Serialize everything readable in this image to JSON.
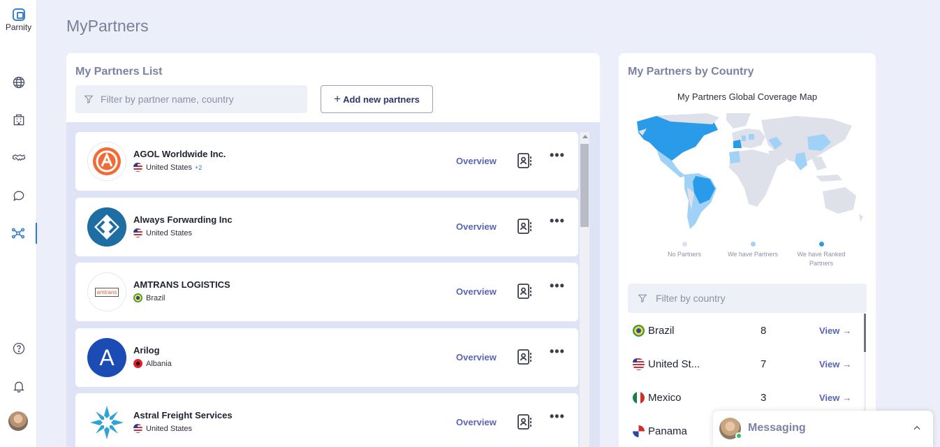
{
  "app": {
    "logo_text": "Parnity",
    "page_title": "MyPartners"
  },
  "sidebar": {
    "items": [
      {
        "name": "globe-icon"
      },
      {
        "name": "building-icon"
      },
      {
        "name": "handshake-icon"
      },
      {
        "name": "chat-icon"
      },
      {
        "name": "network-icon",
        "active": true
      },
      {
        "name": "help-icon"
      },
      {
        "name": "bell-icon"
      }
    ]
  },
  "partners_list": {
    "title": "My Partners List",
    "filter_placeholder": "Filter by partner name, country",
    "add_button_label": "Add new partners",
    "overview_label": "Overview",
    "partners": [
      {
        "name": "AGOL Worldwide Inc.",
        "country": "United States",
        "extra": "+2",
        "flag": "us"
      },
      {
        "name": "Always Forwarding Inc",
        "country": "United States",
        "extra": "",
        "flag": "us"
      },
      {
        "name": "AMTRANS LOGISTICS",
        "country": "Brazil",
        "extra": "",
        "flag": "br",
        "logo_text": "amtrans"
      },
      {
        "name": "Arilog",
        "country": "Albania",
        "extra": "",
        "flag": "al",
        "logo_text": "A"
      },
      {
        "name": "Astral Freight Services",
        "country": "United States",
        "extra": "",
        "flag": "us"
      }
    ]
  },
  "by_country": {
    "title": "My Partners by Country",
    "map_title": "My Partners Global Coverage Map",
    "legend": [
      {
        "label": "No Partners",
        "color": "#dfe1ea"
      },
      {
        "label": "We have Partners",
        "color": "#9fd2f6"
      },
      {
        "label": "We have Ranked Partners",
        "color": "#2a9be8"
      }
    ],
    "filter_placeholder": "Filter by country",
    "view_label": "View",
    "countries": [
      {
        "name": "Brazil",
        "count": "8",
        "flag": "br"
      },
      {
        "name": "United St...",
        "count": "7",
        "flag": "us"
      },
      {
        "name": "Mexico",
        "count": "3",
        "flag": "mx"
      },
      {
        "name": "Panama",
        "count": "",
        "flag": "pa"
      }
    ]
  },
  "messaging": {
    "label": "Messaging"
  },
  "colors": {
    "accent": "#5a64b8",
    "title": "#7b82a3",
    "background": "#eceffa",
    "list_background": "#dfe3f6"
  }
}
